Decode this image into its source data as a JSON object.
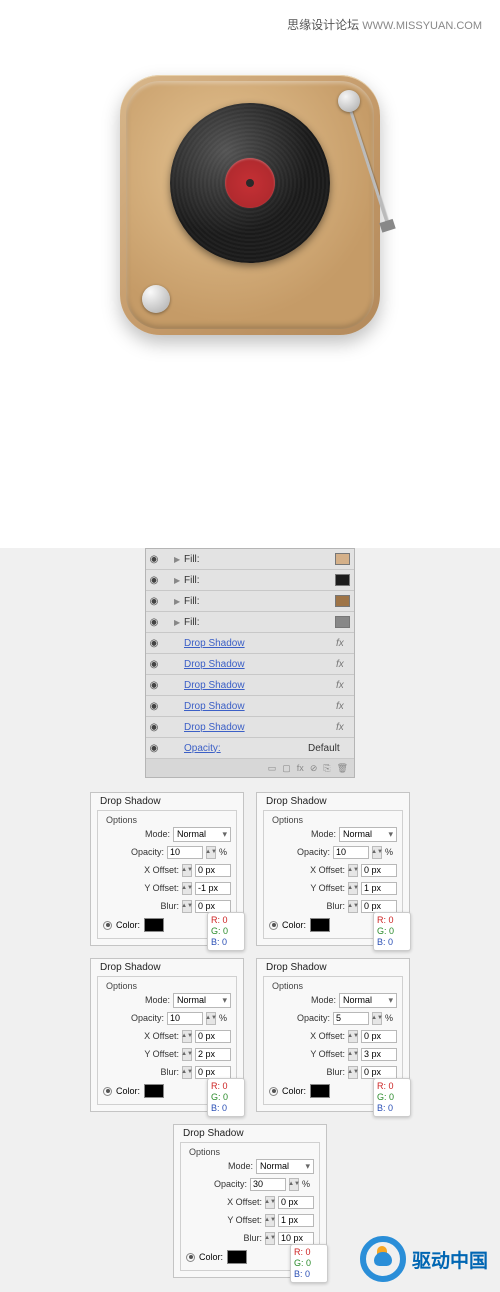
{
  "header": {
    "cn": "思缘设计论坛",
    "url": "WWW.MISSYUAN.COM"
  },
  "layers_panel": {
    "fill_label": "Fill:",
    "fills": [
      {
        "swatch": "sw-tan"
      },
      {
        "swatch": "sw-blk"
      },
      {
        "swatch": "sw-brn"
      },
      {
        "swatch": "sw-gry"
      }
    ],
    "shadow_label": "Drop Shadow",
    "shadow_count": 5,
    "fx_label": "fx",
    "opacity_label": "Opacity:",
    "opacity_value": "Default"
  },
  "drop_shadows": [
    {
      "title": "Drop Shadow",
      "options_label": "Options",
      "mode_label": "Mode:",
      "mode": "Normal",
      "opacity_label": "Opacity:",
      "opacity": "10",
      "opacity_unit": "%",
      "xoff_label": "X Offset:",
      "xoff": "0 px",
      "yoff_label": "Y Offset:",
      "yoff": "-1 px",
      "blur_label": "Blur:",
      "blur": "0 px",
      "color_label": "Color:",
      "rgb": {
        "r": "R: 0",
        "g": "G: 0",
        "b": "B: 0"
      }
    },
    {
      "title": "Drop Shadow",
      "options_label": "Options",
      "mode_label": "Mode:",
      "mode": "Normal",
      "opacity_label": "Opacity:",
      "opacity": "10",
      "opacity_unit": "%",
      "xoff_label": "X Offset:",
      "xoff": "0 px",
      "yoff_label": "Y Offset:",
      "yoff": "1 px",
      "blur_label": "Blur:",
      "blur": "0 px",
      "color_label": "Color:",
      "rgb": {
        "r": "R: 0",
        "g": "G: 0",
        "b": "B: 0"
      }
    },
    {
      "title": "Drop Shadow",
      "options_label": "Options",
      "mode_label": "Mode:",
      "mode": "Normal",
      "opacity_label": "Opacity:",
      "opacity": "10",
      "opacity_unit": "%",
      "xoff_label": "X Offset:",
      "xoff": "0 px",
      "yoff_label": "Y Offset:",
      "yoff": "2 px",
      "blur_label": "Blur:",
      "blur": "0 px",
      "color_label": "Color:",
      "rgb": {
        "r": "R: 0",
        "g": "G: 0",
        "b": "B: 0"
      }
    },
    {
      "title": "Drop Shadow",
      "options_label": "Options",
      "mode_label": "Mode:",
      "mode": "Normal",
      "opacity_label": "Opacity:",
      "opacity": "5",
      "opacity_unit": "%",
      "xoff_label": "X Offset:",
      "xoff": "0 px",
      "yoff_label": "Y Offset:",
      "yoff": "3 px",
      "blur_label": "Blur:",
      "blur": "0 px",
      "color_label": "Color:",
      "rgb": {
        "r": "R: 0",
        "g": "G: 0",
        "b": "B: 0"
      }
    },
    {
      "title": "Drop Shadow",
      "options_label": "Options",
      "mode_label": "Mode:",
      "mode": "Normal",
      "opacity_label": "Opacity:",
      "opacity": "30",
      "opacity_unit": "%",
      "xoff_label": "X Offset:",
      "xoff": "0 px",
      "yoff_label": "Y Offset:",
      "yoff": "1 px",
      "blur_label": "Blur:",
      "blur": "10 px",
      "color_label": "Color:",
      "rgb": {
        "r": "R: 0",
        "g": "G: 0",
        "b": "B: 0"
      }
    }
  ],
  "logo_text": "驱动中国"
}
